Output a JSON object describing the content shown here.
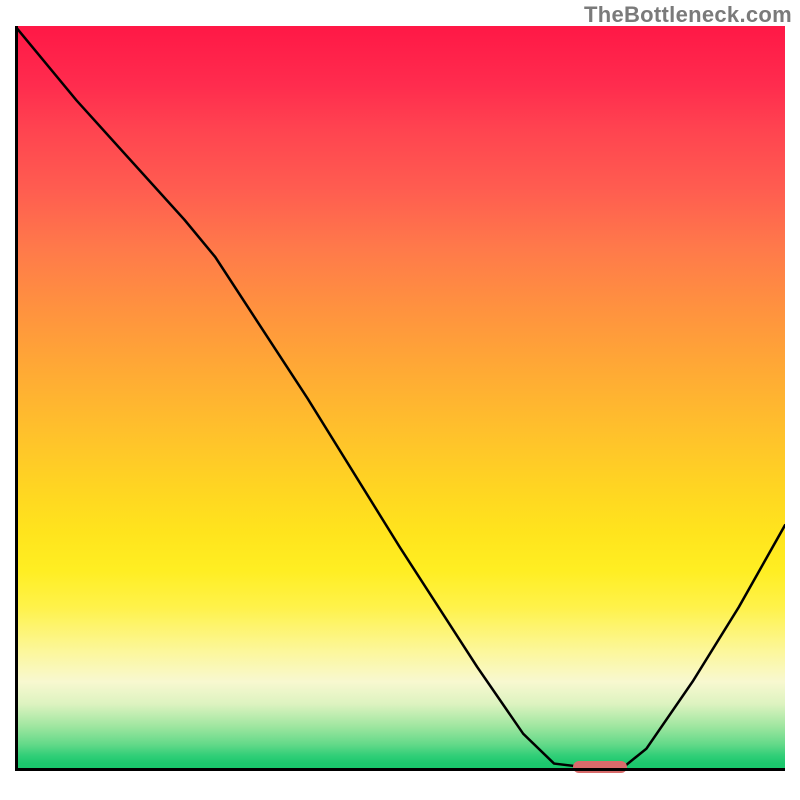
{
  "watermark": "TheBottleneck.com",
  "colors": {
    "top": "#ff1846",
    "bottom": "#19c76c",
    "curve": "#000000",
    "axis": "#000000",
    "marker": "#d86b6b",
    "watermark_text": "#7a7a7a"
  },
  "chart_data": {
    "type": "line",
    "title": "",
    "xlabel": "",
    "ylabel": "",
    "xlim": [
      0,
      100
    ],
    "ylim": [
      0,
      100
    ],
    "grid": false,
    "legend": false,
    "curve_xy": [
      [
        0,
        100
      ],
      [
        8,
        90
      ],
      [
        22,
        74
      ],
      [
        26,
        69
      ],
      [
        38,
        50
      ],
      [
        50,
        30
      ],
      [
        60,
        14
      ],
      [
        66,
        5
      ],
      [
        70,
        1
      ],
      [
        74,
        0.5
      ],
      [
        79,
        0.5
      ],
      [
        82,
        3
      ],
      [
        88,
        12
      ],
      [
        94,
        22
      ],
      [
        100,
        33
      ]
    ],
    "marker": {
      "x_center": 76,
      "y": 0.5,
      "width_pct": 7,
      "height_pct": 1.6
    },
    "annotations": []
  }
}
